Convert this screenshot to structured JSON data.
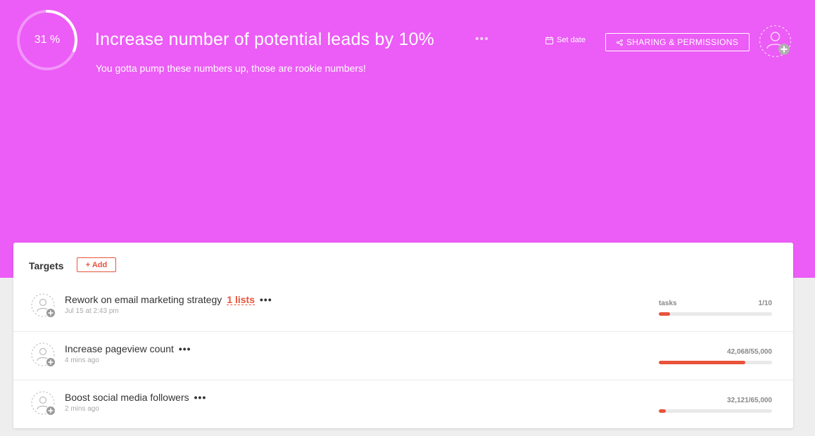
{
  "goal": {
    "progress_text": "31 %",
    "progress_fraction": 0.31,
    "title": "Increase number of potential leads by 10%",
    "more": "•••",
    "description": "You gotta pump these numbers up, those are rookie numbers!",
    "set_date_label": "Set date",
    "set_date_icon": "calendar-icon",
    "share_label": "SHARING & PERMISSIONS",
    "share_icon": "share-icon",
    "owner_icon": "add-user-icon"
  },
  "targets": {
    "label": "Targets",
    "add_label": "+ Add",
    "items": [
      {
        "title": "Rework on email marketing strategy",
        "link": "1 lists",
        "more": "•••",
        "time": "Jul 15 at 2:43 pm",
        "metric_label": "tasks",
        "metric_value": "1/10",
        "fraction": 0.1
      },
      {
        "title": "Increase pageview count",
        "more": "•••",
        "time": "4 mins ago",
        "metric_label": "",
        "metric_value": "42,068/55,000",
        "fraction": 0.765
      },
      {
        "title": "Boost social media followers",
        "more": "•••",
        "time": "2 mins ago",
        "metric_label": "",
        "metric_value": "32,121/65,000",
        "fraction": 0.06
      }
    ]
  },
  "colors": {
    "hero": "#ec5cf6",
    "accent": "#e8533a",
    "track": "#e9e9e9"
  }
}
